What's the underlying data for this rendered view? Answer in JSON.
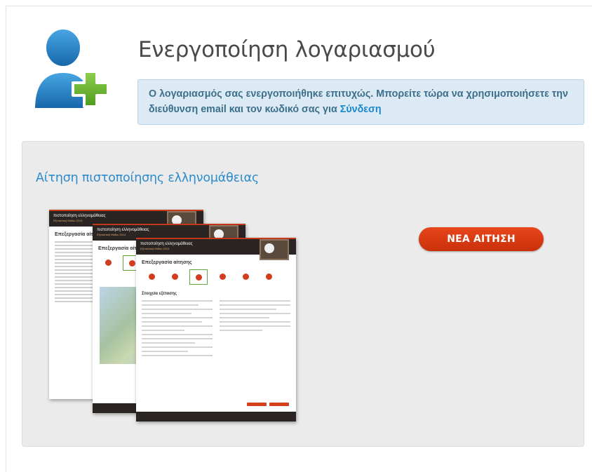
{
  "header": {
    "title": "Ενεργοποίηση λογαριασμού",
    "alert_text": "Ο λογαριασμός σας ενεργοποιήθηκε επιτυχώς. Μπορείτε τώρα να χρησιμοποιήσετε την διεύθυνση email και τον κωδικό σας για",
    "alert_link": "Σύνδεση"
  },
  "panel": {
    "title": "Αίτηση πιστοποίησης ελληνομάθειας",
    "new_button": "ΝΕΑ ΑΙΤΗΣΗ"
  },
  "preview": {
    "doc_title": "πιστοποίηση ελληνομάθειας",
    "doc_heading": "Επεξεργασία αίτησης",
    "doc_section": "Στοιχεία εξέτασης"
  },
  "icons": {
    "avatar": "user-add-icon"
  },
  "colors": {
    "accent": "#2b8ccd",
    "button": "#d4380f",
    "alert_bg": "#dbeaf5",
    "panel_bg": "#ebebeb"
  }
}
